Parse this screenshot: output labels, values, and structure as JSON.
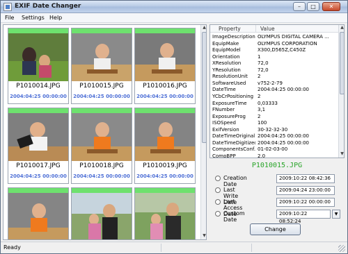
{
  "window": {
    "title": "EXIF Date Changer"
  },
  "menu": [
    "File",
    "Settings",
    "Help"
  ],
  "thumbnails": [
    {
      "name": "P1010014.JPG",
      "date": "2004:04:25 00:00:00"
    },
    {
      "name": "P1010015.JPG",
      "date": "2004:04:25 00:00:00"
    },
    {
      "name": "P1010016.JPG",
      "date": "2004:04:25 00:00:00"
    },
    {
      "name": "P1010017.JPG",
      "date": "2004:04:25 00:00:00"
    },
    {
      "name": "P1010018.JPG",
      "date": "2004:04:25 00:00:00"
    },
    {
      "name": "P1010019.JPG",
      "date": "2004:04:25 00:00:00"
    },
    {
      "name": "",
      "date": ""
    },
    {
      "name": "",
      "date": ""
    },
    {
      "name": "",
      "date": ""
    }
  ],
  "properties": {
    "col_property": "Property",
    "col_value": "Value",
    "rows": [
      {
        "k": "ImageDescription",
        "v": "OLYMPUS DIGITAL CAMERA ..."
      },
      {
        "k": "EquipMake",
        "v": "OLYMPUS CORPORATION"
      },
      {
        "k": "EquipModel",
        "v": "X300,D565Z,C450Z"
      },
      {
        "k": "Orientation",
        "v": "1"
      },
      {
        "k": "XResolution",
        "v": "72,0"
      },
      {
        "k": "YResolution",
        "v": "72,0"
      },
      {
        "k": "ResolutionUnit",
        "v": "2"
      },
      {
        "k": "SoftwareUsed",
        "v": "v752-2-79"
      },
      {
        "k": "DateTime",
        "v": "2004:04:25 00:00:00"
      },
      {
        "k": "YCbCrPositioning",
        "v": "2"
      },
      {
        "k": "ExposureTime",
        "v": "0,03333"
      },
      {
        "k": "FNumber",
        "v": "3,1"
      },
      {
        "k": "ExposureProg",
        "v": "2"
      },
      {
        "k": "ISOSpeed",
        "v": "100"
      },
      {
        "k": "ExifVersion",
        "v": "30-32-32-30"
      },
      {
        "k": "DateTimeOriginal",
        "v": "2004:04:25 00:00:00"
      },
      {
        "k": "DateTimeDigitized",
        "v": "2004:04:25 00:00:00"
      },
      {
        "k": "ComponentsConf...",
        "v": "01-02-03-00"
      },
      {
        "k": "CompBPP",
        "v": "2,0"
      }
    ]
  },
  "selected_file": "P1010015.JPG",
  "dates": [
    {
      "label": "Creation Date",
      "value": "2009:10:22 08:42:36"
    },
    {
      "label": "Last Write Date",
      "value": "2009:04:24 23:00:00"
    },
    {
      "label": "Last Access Date",
      "value": "2009:10:22 00:00:00"
    },
    {
      "label": "Custom Date",
      "value": "2009:10:22 08:52:24"
    }
  ],
  "change_label": "Change",
  "status": "Ready",
  "colors": {
    "header_green": "#6ee16e",
    "date_blue": "#4d6fd6",
    "filename_green": "#28a428"
  }
}
